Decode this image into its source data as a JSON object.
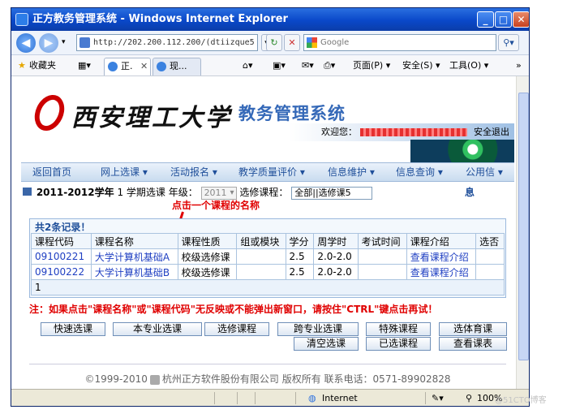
{
  "window": {
    "title": "正方教务管理系统 - Windows Internet Explorer",
    "min": "_",
    "max": "□",
    "close": "✕"
  },
  "browser": {
    "address": "http://202.200.112.200/(dtiizque5",
    "search_placeholder": "Google",
    "favorites_label": "收藏夹",
    "tabs": [
      "正.",
      "现..."
    ],
    "tab_close": "✕",
    "page_menu": "页面(P) ▾",
    "safety_menu": "安全(S) ▾",
    "tools_menu": "工具(O) ▾",
    "more": "»"
  },
  "header": {
    "logo_text": "西安理工大学",
    "system_title": "教务管理系统",
    "welcome_prefix": "欢迎您：",
    "logout": "安全退出"
  },
  "menu": [
    "返回首页 ",
    "网上选课 ▾",
    "活动报名 ▾",
    "教学质量评价 ▾",
    "信息维护 ▾",
    "信息查询 ▾",
    "公用信 ▾"
  ],
  "crumb": {
    "location": "当前位置",
    "year": "2011-2012学年",
    "semester": "1 学期选课",
    "grade_label": "年级：",
    "grade_value": "2011",
    "course_label": "选修课程：",
    "course_value": "全部||选修课5",
    "overlay": "息"
  },
  "annotation": "点击一个课程的名称",
  "table": {
    "count": "共2条记录！",
    "headers": [
      "课程代码",
      "课程名称",
      "课程性质",
      "组或模块",
      "学分",
      "周学时",
      "考试时间",
      "课程介绍",
      "选否"
    ],
    "rows": [
      [
        "09100221",
        "大学计算机基础A",
        "校级选修课",
        "",
        "2.5",
        "2.0-2.0",
        "",
        "查看课程介绍",
        ""
      ],
      [
        "09100222",
        "大学计算机基础B",
        "校级选修课",
        "",
        "2.5",
        "2.0-2.0",
        "",
        "查看课程介绍",
        ""
      ]
    ],
    "total": "1"
  },
  "warning": "注：如果点击\"课程名称\"或\"课程代码\"无反映或不能弹出新窗口，请按住\"CTRL\"键点击再试！",
  "buttons": {
    "row1": [
      "快速选课",
      "本专业选课",
      "选修课程",
      "跨专业选课",
      "特殊课程",
      "选体育课"
    ],
    "row2": [
      "清空选课",
      "已选课程",
      "查看课表"
    ]
  },
  "footer": {
    "copyright": "©1999-2010",
    "company": "杭州正方软件股份有限公司 版权所有 联系电话：0571-89902828"
  },
  "status": {
    "zone": "Internet",
    "zoom": "100%"
  },
  "watermark": "@51CTO博客"
}
